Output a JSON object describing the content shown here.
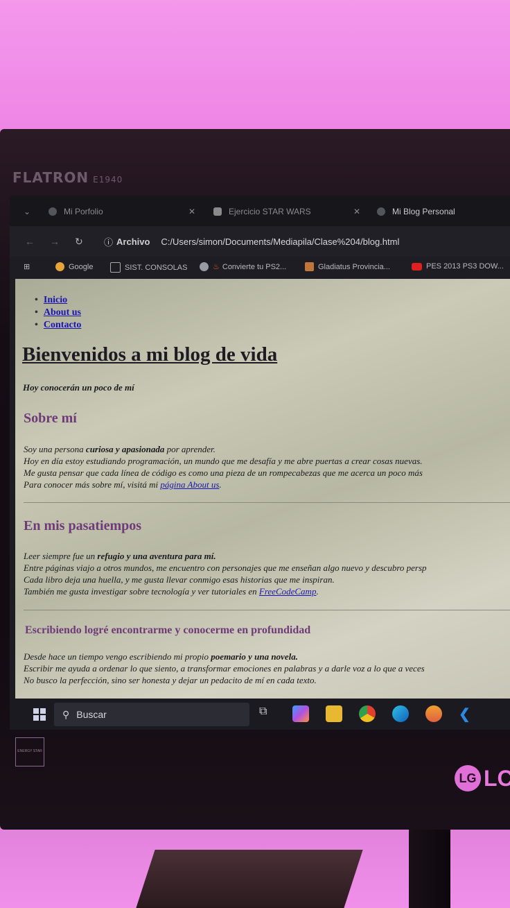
{
  "monitor": {
    "brand": "FLATRON",
    "model": "E1940",
    "energy_label": "ENERGY STAR",
    "logo_text": "LG",
    "logo_partial": "LC"
  },
  "tabs": [
    {
      "label": "Mi Porfolio"
    },
    {
      "label": "Ejercicio STAR WARS"
    },
    {
      "label": "Mi Blog Personal"
    }
  ],
  "address_bar": {
    "scheme_label": "Archivo",
    "url": "C:/Users/simon/Documents/Mediapila/Clase%204/blog.html"
  },
  "bookmarks": [
    "Google",
    "SIST. CONSOLAS",
    "Convierte tu PS2...",
    "Gladiatus Provincia...",
    "PES 2013 PS3 DOW..."
  ],
  "page": {
    "nav": [
      "Inicio",
      "About us",
      "Contacto"
    ],
    "title": "Bienvenidos a mi blog de vida",
    "intro": "Hoy conocerán un poco de mí",
    "sections": [
      {
        "heading": "Sobre mí",
        "line1_pre": "Soy una persona ",
        "line1_bold": "curiosa y apasionada",
        "line1_post": " por aprender.",
        "line2": "Hoy en día estoy estudiando programación, un mundo que me desafía y me abre puertas a crear cosas nuevas.",
        "line3": "Me gusta pensar que cada línea de código es como una pieza de un rompecabezas que me acerca un poco más",
        "line4_pre": "Para conocer más sobre mí, visitá mi ",
        "line4_link": "página About us",
        "line4_post": "."
      },
      {
        "heading": "En mis pasatiempos",
        "line1_pre": "Leer siempre fue un ",
        "line1_bold": "refugio y una aventura para mí.",
        "line2": "Entre páginas viajo a otros mundos, me encuentro con personajes que me enseñan algo nuevo y descubro persp",
        "line3": "Cada libro deja una huella, y me gusta llevar conmigo esas historias que me inspiran.",
        "line4_pre": "También me gusta investigar sobre tecnología y ver tutoriales en ",
        "line4_link": "FreeCodeCamp",
        "line4_post": "."
      },
      {
        "heading": "Escribiendo logré encontrarme y conocerme en profundidad",
        "line1_pre": "Desde hace un tiempo vengo escribiendo mi propio ",
        "line1_bold": "poemario y una novela.",
        "line2": "Escribir me ayuda a ordenar lo que siento, a transformar emociones en palabras y a darle voz a lo que a veces",
        "line3": "No busco la perfección, sino ser honesta y dejar un pedacito de mí en cada texto."
      }
    ]
  },
  "taskbar": {
    "search_placeholder": "Buscar"
  },
  "colors": {
    "heading_purple": "#6e3a78",
    "link_blue": "#1a14b0",
    "wall_pink": "#f08ce8"
  }
}
